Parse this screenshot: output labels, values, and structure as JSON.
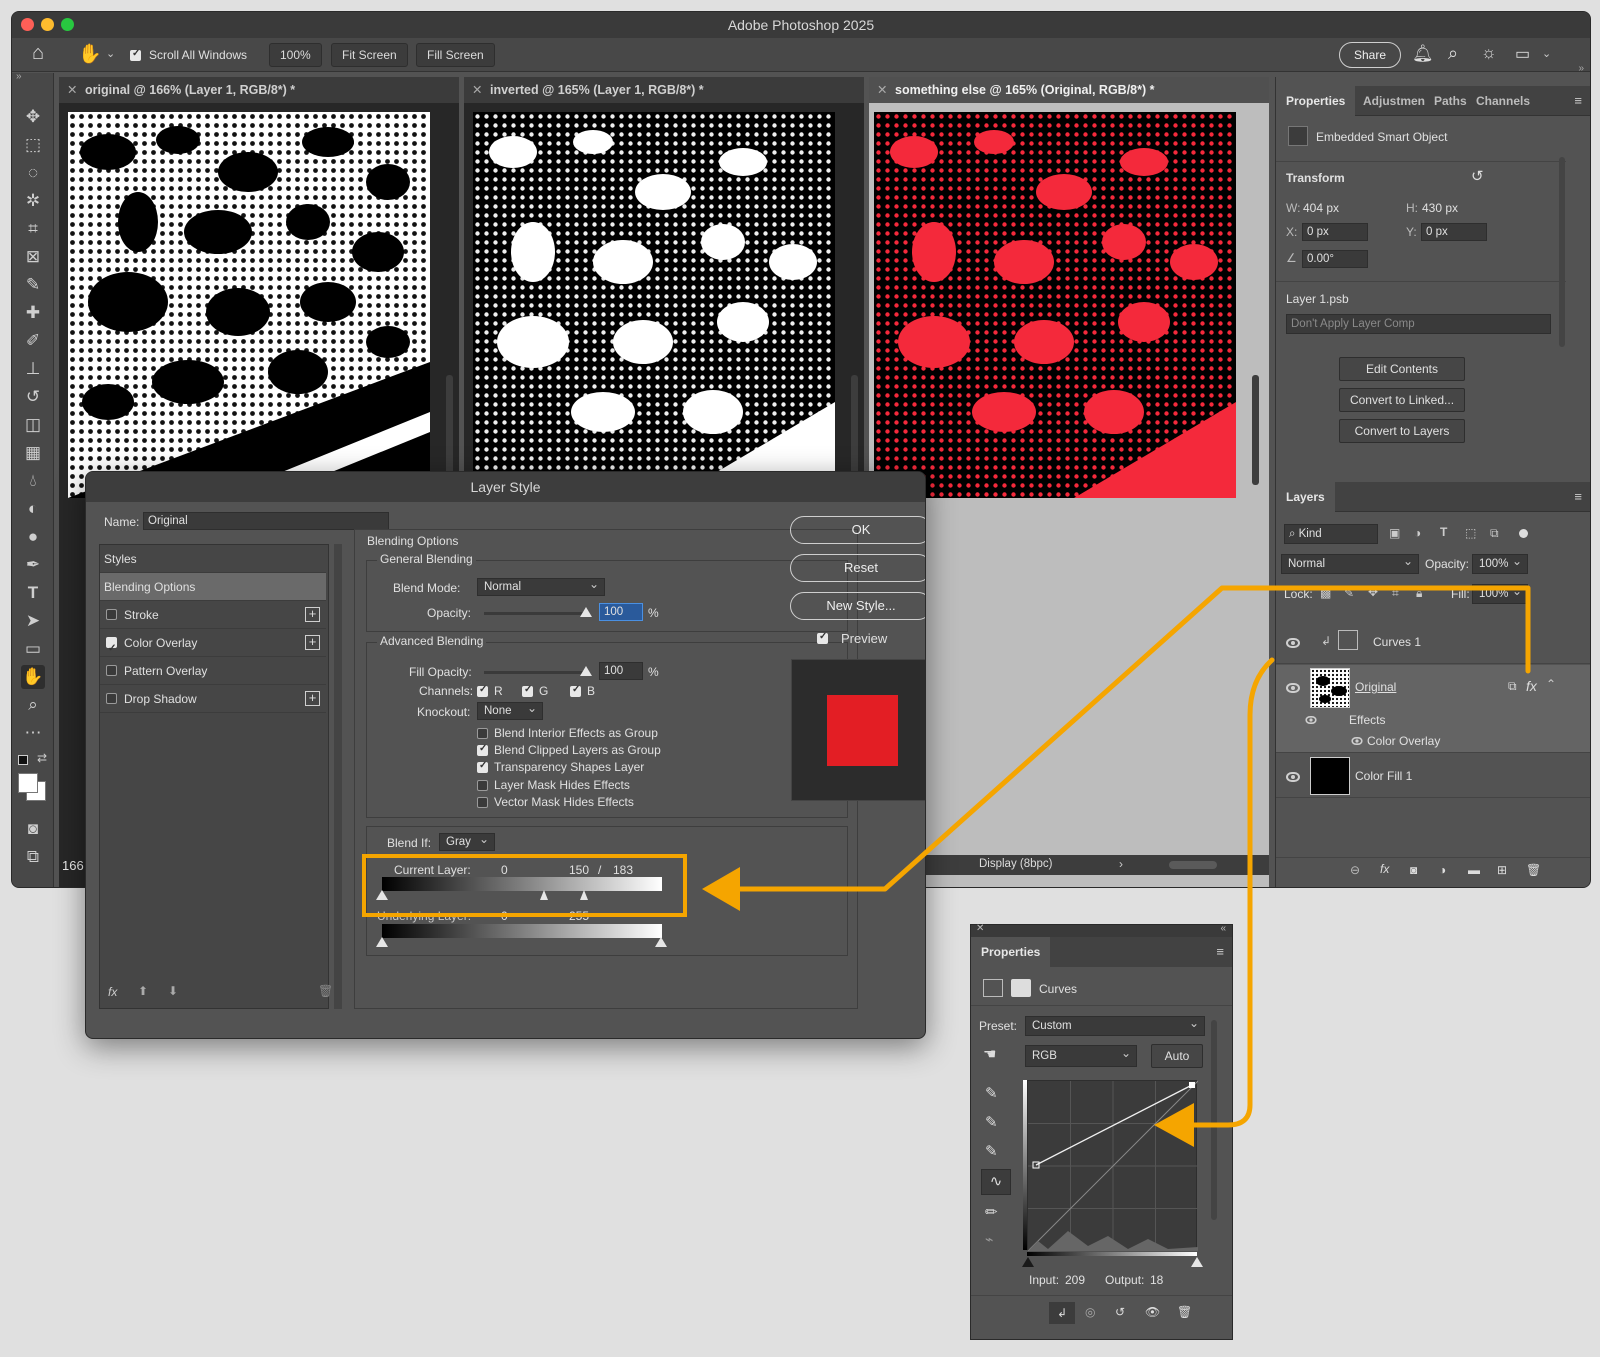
{
  "app": {
    "title": "Adobe Photoshop 2025"
  },
  "options_bar": {
    "scroll_all_windows": "Scroll All Windows",
    "zoom": "100%",
    "fit_screen": "Fit Screen",
    "fill_screen": "Fill Screen",
    "share": "Share"
  },
  "documents": [
    {
      "tab": "original @ 166% (Layer 1, RGB/8*) *",
      "zoom_readout": "166"
    },
    {
      "tab": "inverted @ 165% (Layer 1, RGB/8*) *"
    },
    {
      "tab": "something else @ 165% (Original, RGB/8*) *",
      "status": "Display (8bpc)"
    }
  ],
  "properties_panel": {
    "tabs": [
      "Properties",
      "Adjustmen",
      "Paths",
      "Channels"
    ],
    "object_type": "Embedded Smart Object",
    "transform_title": "Transform",
    "w_label": "W:",
    "w_value": "404 px",
    "h_label": "H:",
    "h_value": "430 px",
    "x_label": "X:",
    "x_value": "0 px",
    "y_label": "Y:",
    "y_value": "0 px",
    "angle_value": "0.00°",
    "file_name": "Layer 1.psb",
    "layer_comp": "Don't Apply Layer Comp",
    "edit_contents": "Edit Contents",
    "convert_linked": "Convert to Linked...",
    "convert_layers": "Convert to Layers"
  },
  "layers_panel": {
    "title": "Layers",
    "kind": "Kind",
    "blend_mode": "Normal",
    "opacity_label": "Opacity:",
    "opacity_value": "100%",
    "lock_label": "Lock:",
    "fill_label": "Fill:",
    "fill_value": "100%",
    "layers": [
      {
        "name": "Curves 1"
      },
      {
        "name": "Original"
      },
      {
        "name": "Effects"
      },
      {
        "name": "Color Overlay"
      },
      {
        "name": "Color Fill 1"
      }
    ]
  },
  "layer_style": {
    "title": "Layer Style",
    "name_label": "Name:",
    "name_value": "Original",
    "styles_header": "Styles",
    "blending_options": "Blending Options",
    "style_items": [
      {
        "label": "Stroke",
        "checked": false
      },
      {
        "label": "Color Overlay",
        "checked": true
      },
      {
        "label": "Pattern Overlay",
        "checked": false
      },
      {
        "label": "Drop Shadow",
        "checked": false
      }
    ],
    "section_title": "Blending Options",
    "general_blending": "General Blending",
    "blend_mode_label": "Blend Mode:",
    "blend_mode_value": "Normal",
    "opacity_label": "Opacity:",
    "opacity_value": "100",
    "percent": "%",
    "advanced_blending": "Advanced Blending",
    "fill_opacity_label": "Fill Opacity:",
    "fill_opacity_value": "100",
    "channels_label": "Channels:",
    "channel_r": "R",
    "channel_g": "G",
    "channel_b": "B",
    "knockout_label": "Knockout:",
    "knockout_value": "None",
    "options": [
      {
        "label": "Blend Interior Effects as Group",
        "checked": false
      },
      {
        "label": "Blend Clipped Layers as Group",
        "checked": true
      },
      {
        "label": "Transparency Shapes Layer",
        "checked": true
      },
      {
        "label": "Layer Mask Hides Effects",
        "checked": false
      },
      {
        "label": "Vector Mask Hides Effects",
        "checked": false
      }
    ],
    "blend_if_label": "Blend If:",
    "blend_if_value": "Gray",
    "current_layer_label": "Current Layer:",
    "current_low": "0",
    "current_mid": "150",
    "current_slash": "/",
    "current_high": "183",
    "underlying_label": "Underlying Layer:",
    "underlying_low": "0",
    "underlying_high": "255",
    "ok": "OK",
    "reset": "Reset",
    "new_style": "New Style...",
    "preview": "Preview",
    "preview_color": "#e31e24"
  },
  "curves_panel": {
    "title": "Properties",
    "type": "Curves",
    "preset_label": "Preset:",
    "preset_value": "Custom",
    "channel_value": "RGB",
    "auto": "Auto",
    "input_label": "Input:",
    "input_value": "209",
    "output_label": "Output:",
    "output_value": "18"
  },
  "colors": {
    "accent_orange": "#f5a500",
    "overlay_red": "#f4293b"
  }
}
